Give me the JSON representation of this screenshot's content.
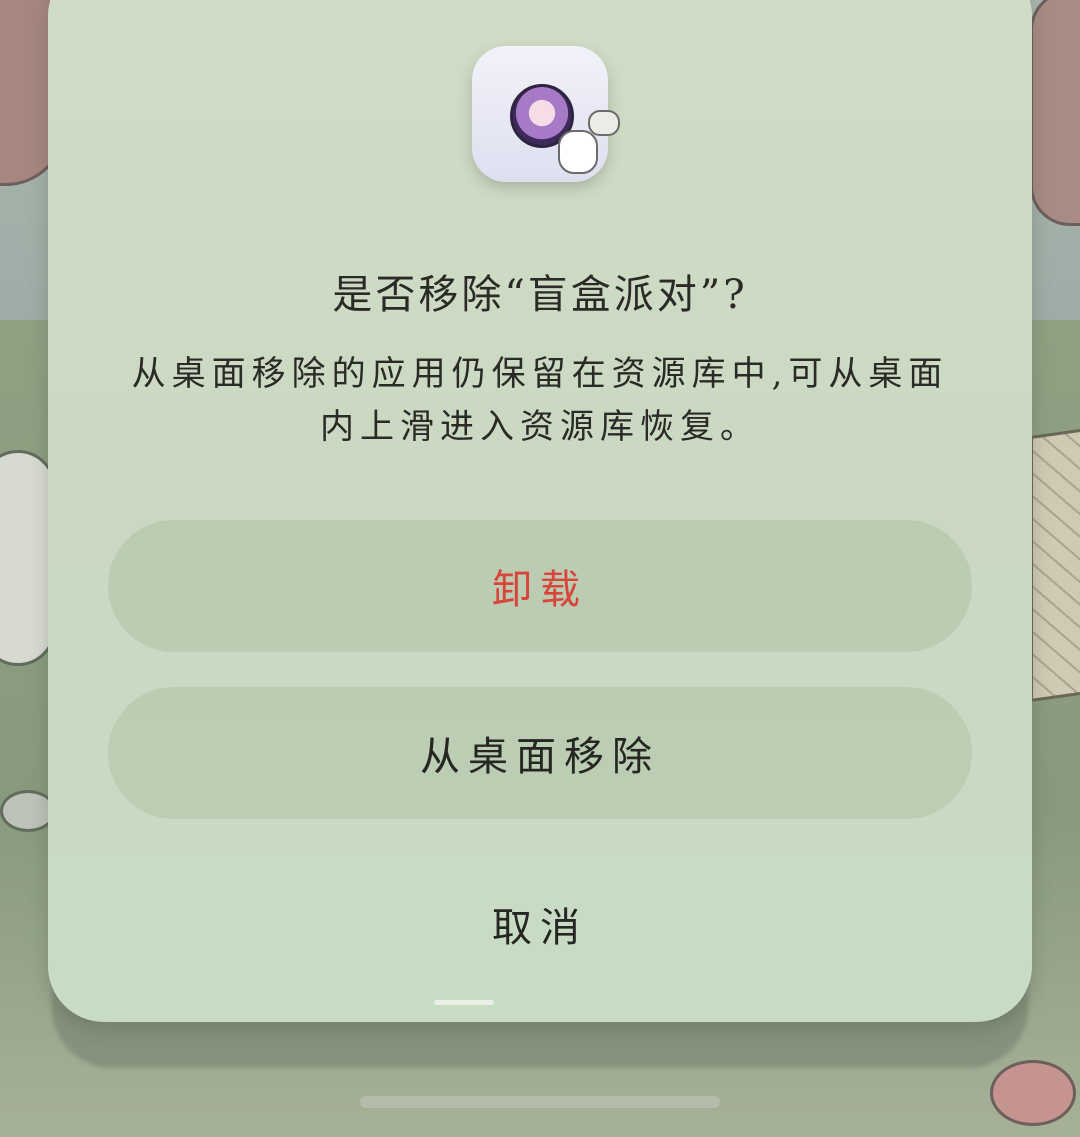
{
  "dialog": {
    "app_name": "盲盒派对",
    "title": "是否移除“盲盒派对”?",
    "message": "从桌面移除的应用仍保留在资源库中,可从桌面内上滑进入资源库恢复。",
    "buttons": {
      "uninstall": "卸载",
      "remove_from_desktop": "从桌面移除",
      "cancel": "取消"
    }
  },
  "colors": {
    "dialog_background": "#cad8c2",
    "destructive_text": "#d8453a",
    "primary_text": "#262622"
  },
  "icons": {
    "app_icon": "blind-box-party-app-icon"
  }
}
